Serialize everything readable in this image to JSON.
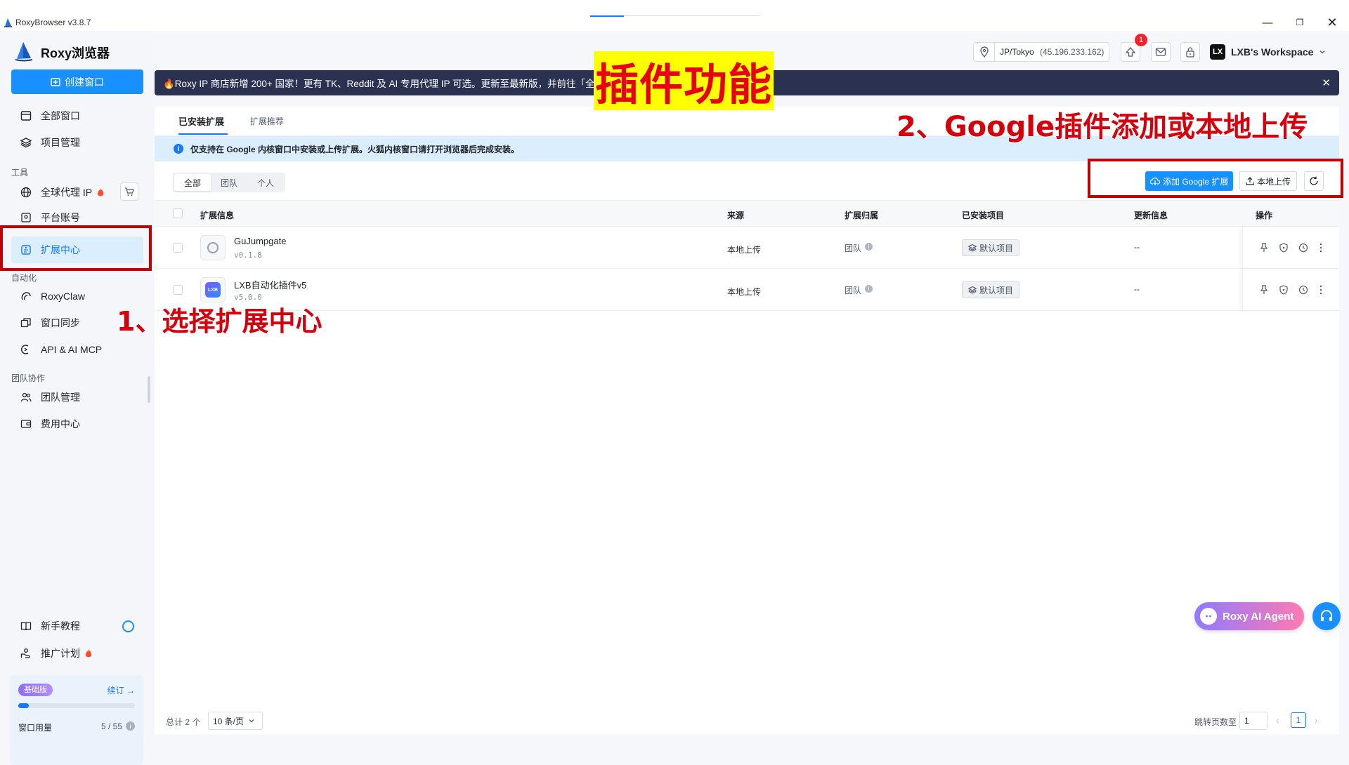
{
  "window": {
    "title": "RoxyBrowser v3.8.7"
  },
  "sidebar": {
    "app_name": "Roxy浏览器",
    "create_button": "创建窗口",
    "items": [
      {
        "label": "全部窗口"
      },
      {
        "label": "项目管理"
      }
    ],
    "section_tools": "工具",
    "tools": [
      {
        "label": "全球代理 IP"
      },
      {
        "label": "平台账号"
      },
      {
        "label": "扩展中心"
      }
    ],
    "section_automation": "自动化",
    "automation": [
      {
        "label": "RoxyClaw"
      },
      {
        "label": "窗口同步"
      },
      {
        "label": "API & AI MCP"
      }
    ],
    "section_team": "团队协作",
    "team": [
      {
        "label": "团队管理"
      },
      {
        "label": "费用中心"
      }
    ],
    "bottom": [
      {
        "label": "新手教程"
      },
      {
        "label": "推广计划"
      }
    ],
    "plan": {
      "badge": "基础版",
      "renew": "续订 →",
      "usage_label": "窗口用量",
      "usage_value": "5 / 55",
      "usage_fraction": 0.09
    }
  },
  "topbar": {
    "location": "JP/Tokyo",
    "ip": "(45.196.233.162)",
    "notification_count": "1",
    "avatar_initials": "LX",
    "workspace": "LXB's Workspace"
  },
  "announcement": {
    "text": "🔥Roxy IP 商店新增 200+ 国家！更有 TK、Reddit 及 AI 专用代理 IP 可选。更新至最新版，并前往「全球"
  },
  "tabs": [
    {
      "label": "已安装扩展"
    },
    {
      "label": "扩展推荐"
    }
  ],
  "info": {
    "text": "仅支持在 Google 内核窗口中安装或上传扩展。火狐内核窗口请打开浏览器后完成安装。"
  },
  "filter": [
    {
      "label": "全部"
    },
    {
      "label": "团队"
    },
    {
      "label": "个人"
    }
  ],
  "toolbar": {
    "add_google": "添加 Google 扩展",
    "local_upload": "本地上传"
  },
  "table": {
    "headers": [
      "扩展信息",
      "来源",
      "扩展归属",
      "已安装项目",
      "更新信息",
      "操作"
    ],
    "rows": [
      {
        "name": "GuJumpgate",
        "version": "v0.1.8",
        "source": "本地上传",
        "owner": "团队",
        "project": "默认项目",
        "update": "--"
      },
      {
        "name": "LXB自动化插件v5",
        "version": "v5.0.0",
        "source": "本地上传",
        "owner": "团队",
        "project": "默认项目",
        "update": "--",
        "icon_text": "LXB"
      }
    ]
  },
  "pager": {
    "total": "总计 2 个",
    "page_size": "10 条/页",
    "jump_label": "跳转页数至",
    "jump_value": "1",
    "current": "1"
  },
  "agent": {
    "label": "Roxy AI Agent"
  },
  "annotations": {
    "title": "插件功能",
    "step1": "1、选择扩展中心",
    "step2": "2、Google插件添加或本地上传"
  }
}
